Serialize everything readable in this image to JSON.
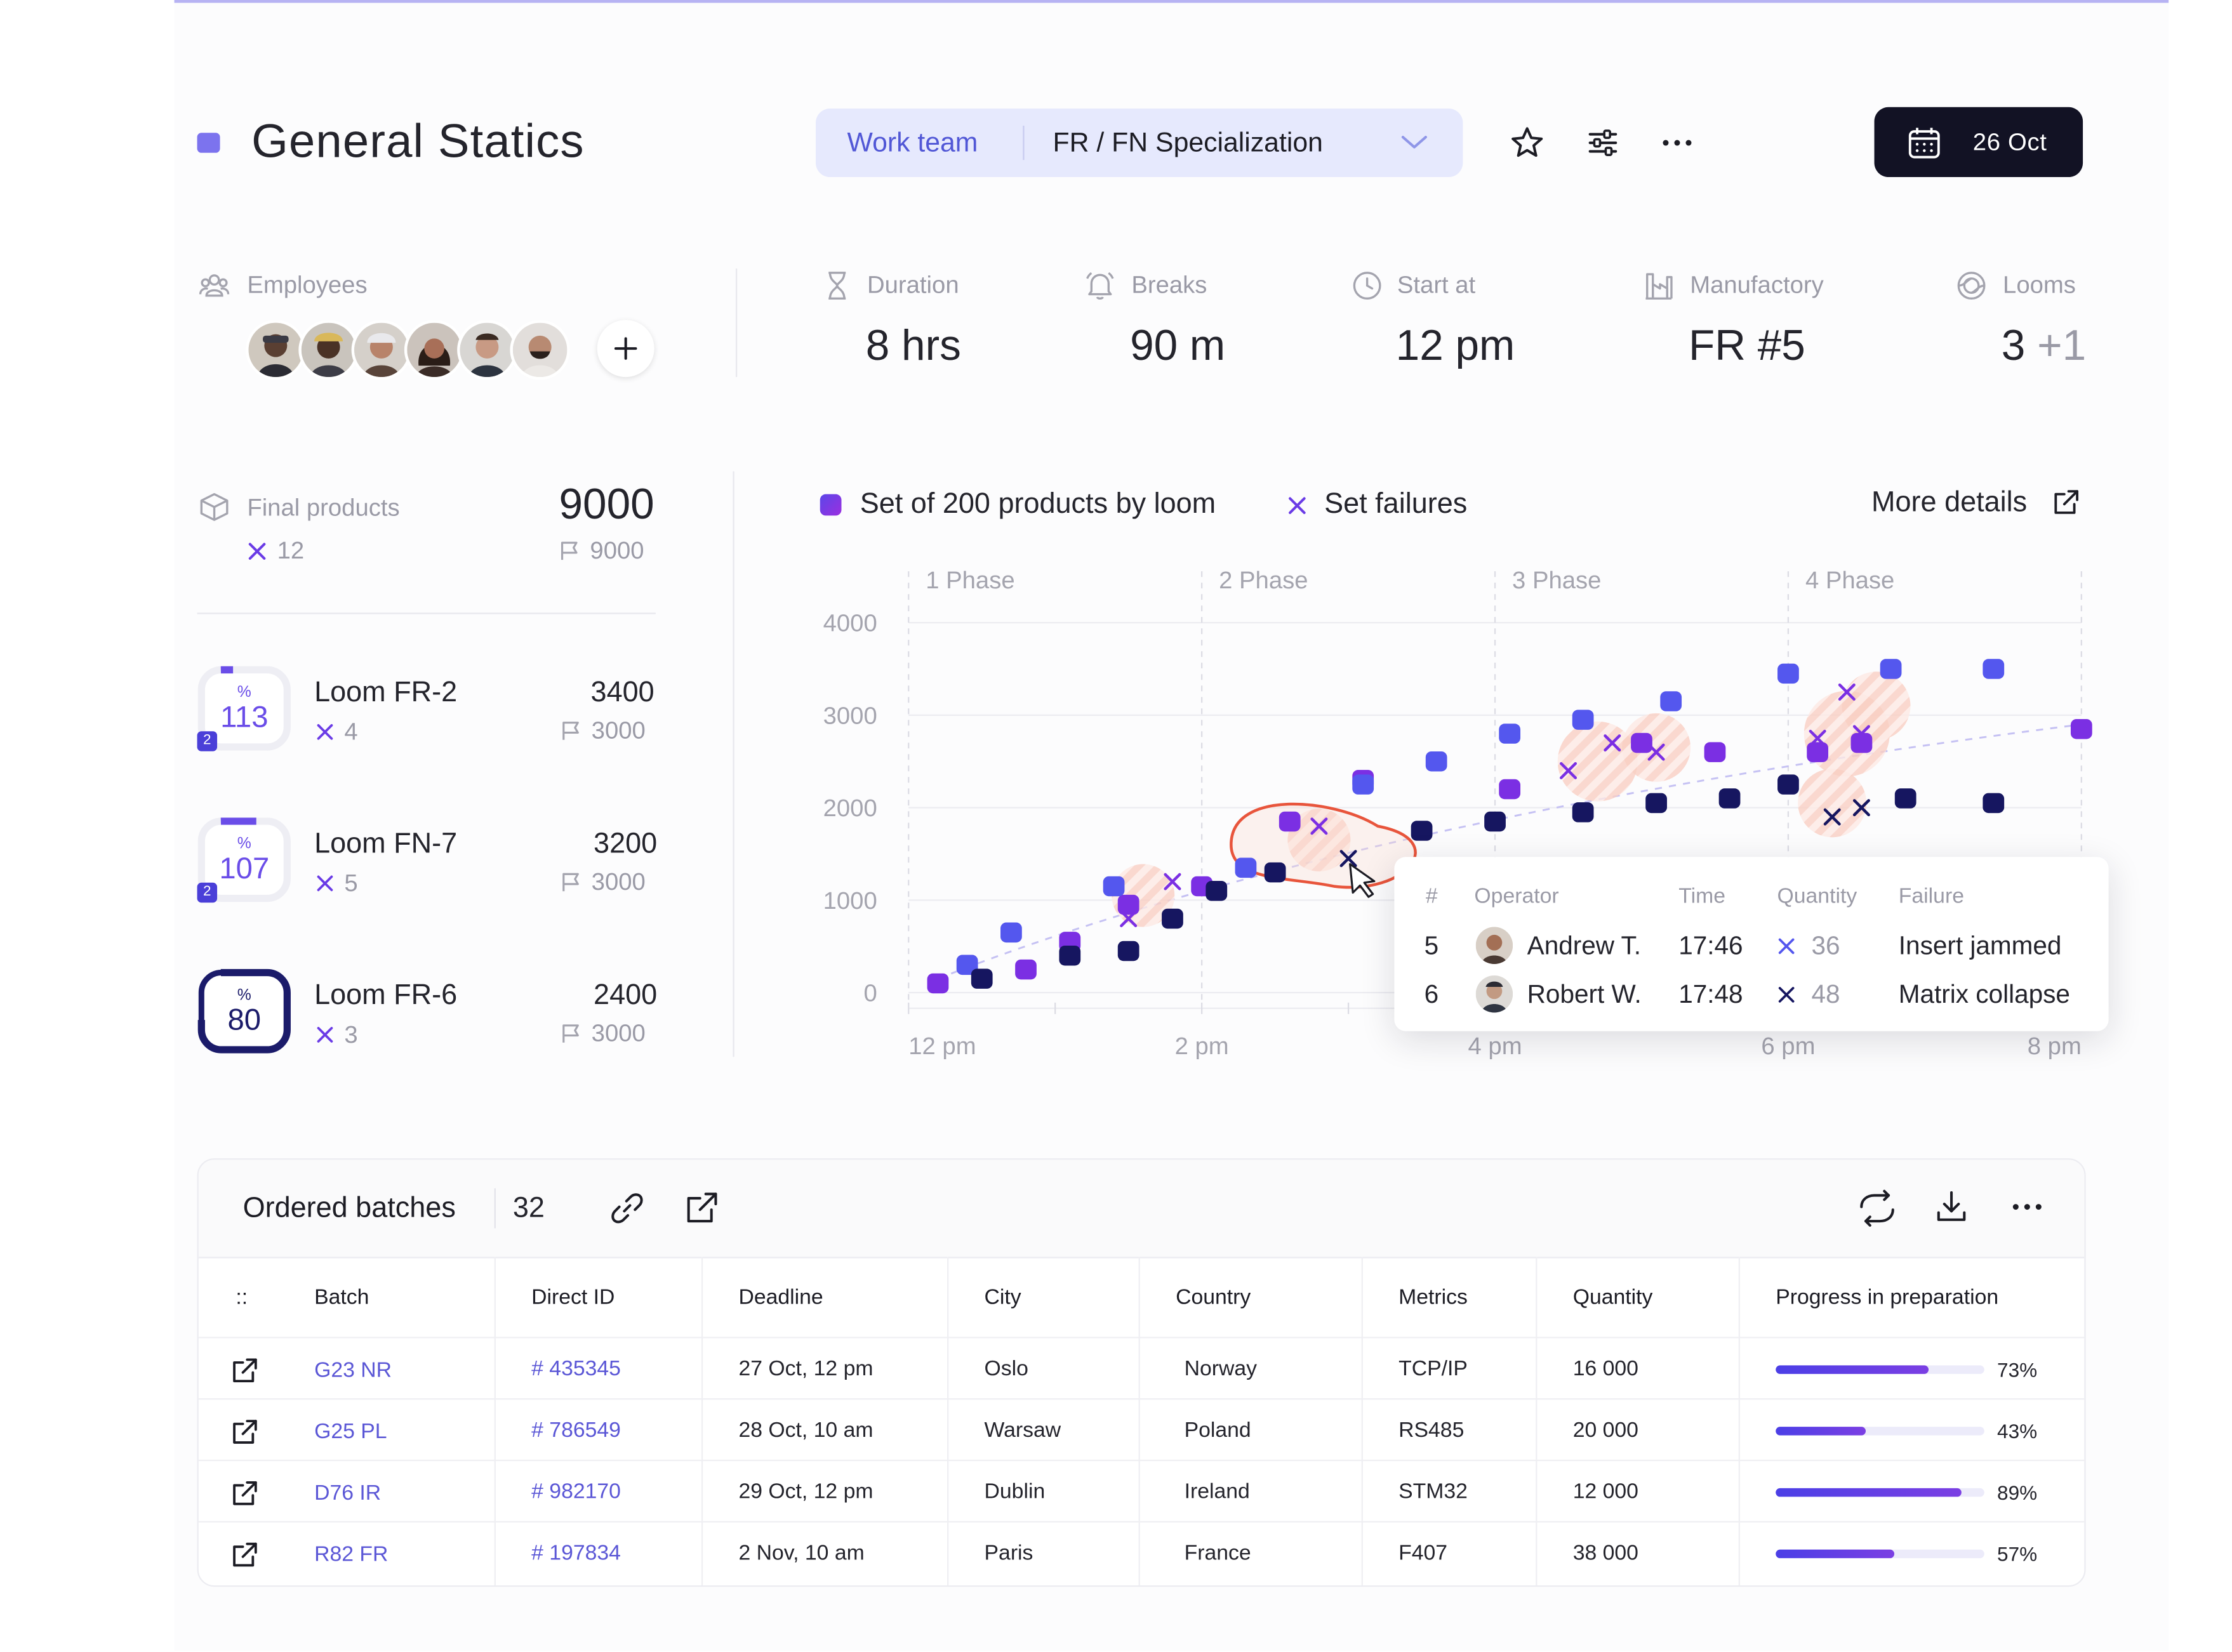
{
  "header": {
    "title": "General Statics",
    "team_label": "Work team",
    "team_value": "FR / FN Specialization",
    "date": "26 Oct",
    "icons": [
      "star-icon",
      "filters-icon",
      "more-icon",
      "calendar-icon",
      "chevron-down-icon"
    ]
  },
  "stats": {
    "employees_label": "Employees",
    "duration_label": "Duration",
    "duration_value": "8 hrs",
    "breaks_label": "Breaks",
    "breaks_value": "90 m",
    "start_label": "Start at",
    "start_value": "12 pm",
    "manufactory_label": "Manufactory",
    "manufactory_value": "FR #5",
    "looms_label": "Looms",
    "looms_value": "3",
    "looms_extra": "+1"
  },
  "final_products": {
    "label": "Final products",
    "value": "9000",
    "failures": "12",
    "target": "9000"
  },
  "looms": [
    {
      "name": "Loom FR-2",
      "percent": "113",
      "percent_symbol": "%",
      "badge": "2",
      "failures": "4",
      "value": "3400",
      "target": "3000",
      "ring_fill": 0.04
    },
    {
      "name": "Loom FN-7",
      "percent": "107",
      "percent_symbol": "%",
      "badge": "2",
      "failures": "5",
      "value": "3200",
      "target": "3000",
      "ring_fill": 0.12
    },
    {
      "name": "Loom FR-6",
      "percent": "80",
      "percent_symbol": "%",
      "badge": "",
      "failures": "3",
      "value": "2400",
      "target": "3000",
      "ring_fill": 0.8
    }
  ],
  "chart_header": {
    "legend_set": "Set of 200 products by loom",
    "legend_failures": "Set failures",
    "more_details": "More details"
  },
  "chart_data": {
    "type": "scatter",
    "phases": [
      "1 Phase",
      "2 Phase",
      "3 Phase",
      "4 Phase"
    ],
    "x_ticks": [
      "12 pm",
      "2 pm",
      "4 pm",
      "6 pm",
      "8 pm"
    ],
    "y_ticks": [
      "4000",
      "3000",
      "2000",
      "1000",
      "0"
    ],
    "ylim": [
      0,
      4000
    ],
    "xlim": [
      12,
      20
    ],
    "series": [
      {
        "name": "Set of 200 products by loom",
        "color": "#7b2fe3",
        "points": [
          [
            12.2,
            100
          ],
          [
            12.8,
            250
          ],
          [
            13.1,
            550
          ],
          [
            13.5,
            950
          ],
          [
            14.0,
            1150
          ],
          [
            14.6,
            1850
          ],
          [
            15.1,
            2300
          ],
          [
            16.1,
            2200
          ],
          [
            17.0,
            2700
          ],
          [
            17.5,
            2600
          ],
          [
            18.2,
            2600
          ],
          [
            18.5,
            2700
          ],
          [
            20.0,
            2850
          ]
        ]
      },
      {
        "name": "Set of 200 products by loom",
        "color": "#5457ee",
        "points": [
          [
            12.4,
            300
          ],
          [
            12.7,
            650
          ],
          [
            13.4,
            1150
          ],
          [
            14.3,
            1350
          ],
          [
            15.1,
            2250
          ],
          [
            15.6,
            2500
          ],
          [
            16.1,
            2800
          ],
          [
            16.6,
            2950
          ],
          [
            17.2,
            3150
          ],
          [
            18.0,
            3450
          ],
          [
            18.7,
            3500
          ],
          [
            19.4,
            3500
          ]
        ]
      },
      {
        "name": "Set of 200 products by loom",
        "color": "#161660",
        "points": [
          [
            12.5,
            150
          ],
          [
            13.1,
            400
          ],
          [
            13.5,
            450
          ],
          [
            13.8,
            800
          ],
          [
            14.1,
            1100
          ],
          [
            14.5,
            1300
          ],
          [
            15.5,
            1750
          ],
          [
            16.0,
            1850
          ],
          [
            16.6,
            1950
          ],
          [
            17.1,
            2050
          ],
          [
            17.6,
            2100
          ],
          [
            18.0,
            2250
          ],
          [
            18.8,
            2100
          ],
          [
            19.4,
            2050
          ]
        ]
      },
      {
        "name": "Set failures",
        "color": "#7b2fe3",
        "marker": "x",
        "points": [
          [
            13.5,
            800
          ],
          [
            13.8,
            1200
          ],
          [
            14.8,
            1800
          ],
          [
            16.5,
            2400
          ],
          [
            16.8,
            2700
          ],
          [
            17.1,
            2600
          ],
          [
            18.2,
            2750
          ],
          [
            18.4,
            3250
          ],
          [
            18.5,
            2800
          ]
        ]
      },
      {
        "name": "Set failures",
        "color": "#161660",
        "marker": "x",
        "points": [
          [
            15.0,
            1450
          ],
          [
            18.3,
            1900
          ],
          [
            18.5,
            2000
          ]
        ]
      }
    ]
  },
  "tooltip": {
    "headers": [
      "#",
      "Operator",
      "Time",
      "Quantity",
      "Failure"
    ],
    "rows": [
      {
        "num": "5",
        "operator": "Andrew T.",
        "time": "17:46",
        "quantity": "36",
        "failure": "Insert jammed"
      },
      {
        "num": "6",
        "operator": "Robert W.",
        "time": "17:48",
        "quantity": "48",
        "failure": "Matrix collapse"
      }
    ]
  },
  "table": {
    "title": "Ordered batches",
    "count": "32",
    "columns": [
      "::",
      "Batch",
      "Direct ID",
      "Deadline",
      "City",
      "Country",
      "Metrics",
      "Quantity",
      "Progress in preparation"
    ],
    "rows": [
      {
        "batch": "G23 NR",
        "id": "# 435345",
        "deadline": "27 Oct, 12 pm",
        "city": "Oslo",
        "country": "Norway",
        "metrics": "TCP/IP",
        "quantity": "16 000",
        "progress": 73,
        "progress_label": "73%"
      },
      {
        "batch": "G25 PL",
        "id": "# 786549",
        "deadline": "28 Oct, 10 am",
        "city": "Warsaw",
        "country": "Poland",
        "metrics": "RS485",
        "quantity": "20 000",
        "progress": 43,
        "progress_label": "43%"
      },
      {
        "batch": "D76 IR",
        "id": "# 982170",
        "deadline": "29 Oct, 12 pm",
        "city": "Dublin",
        "country": "Ireland",
        "metrics": "STM32",
        "quantity": "12 000",
        "progress": 89,
        "progress_label": "89%"
      },
      {
        "batch": "R82 FR",
        "id": "# 197834",
        "deadline": "2 Nov, 10 am",
        "city": "Paris",
        "country": "France",
        "metrics": "F407",
        "quantity": "38 000",
        "progress": 57,
        "progress_label": "57%"
      }
    ]
  },
  "colors": {
    "accent": "#7c73ee",
    "dark": "#121224",
    "purple": "#7b2fe3",
    "blue": "#5457ee",
    "navy": "#161660",
    "highlight": "#e8553c"
  }
}
